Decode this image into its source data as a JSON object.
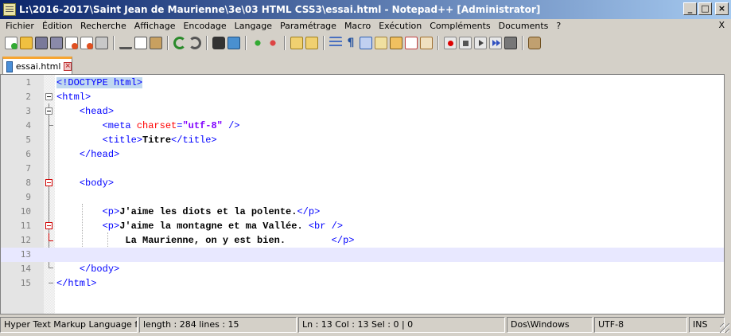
{
  "window": {
    "title": "L:\\2016-2017\\Saint Jean de Maurienne\\3e\\03 HTML CSS3\\essai.html - Notepad++ [Administrator]",
    "minimize": "_",
    "maximize": "□",
    "close": "×"
  },
  "menu": {
    "items": [
      "Fichier",
      "Édition",
      "Recherche",
      "Affichage",
      "Encodage",
      "Langage",
      "Paramétrage",
      "Macro",
      "Exécution",
      "Compléments",
      "Documents",
      "?"
    ],
    "close_label": "X"
  },
  "toolbar": {
    "icons": [
      "new-file-icon",
      "open-file-icon",
      "save-icon",
      "save-all-icon",
      "close-icon",
      "close-all-icon",
      "print-icon",
      "cut-icon",
      "copy-icon",
      "paste-icon",
      "undo-icon",
      "redo-icon",
      "find-icon",
      "replace-icon",
      "zoom-in-icon",
      "zoom-out-icon",
      "sync-vertical-icon",
      "sync-horizontal-icon",
      "word-wrap-icon",
      "show-all-chars-icon",
      "indent-guide-icon",
      "user-language-icon",
      "doc-map-icon",
      "function-list-icon",
      "folder-workspace-icon",
      "record-macro-icon",
      "stop-macro-icon",
      "play-macro-icon",
      "run-macro-multiple-icon",
      "save-macro-icon",
      "plugin-icon"
    ]
  },
  "tab": {
    "label": "essai.html"
  },
  "editor": {
    "line_numbers": [
      "1",
      "2",
      "3",
      "4",
      "5",
      "6",
      "7",
      "8",
      "9",
      "10",
      "11",
      "12",
      "13",
      "14",
      "15"
    ],
    "current_line": 13
  },
  "statusbar": {
    "language": "Hyper Text Markup Language file",
    "length": "length : 284    lines : 15",
    "position": "Ln : 13    Col : 13    Sel : 0 | 0",
    "eol": "Dos\\Windows",
    "encoding": "UTF-8",
    "mode": "INS"
  }
}
